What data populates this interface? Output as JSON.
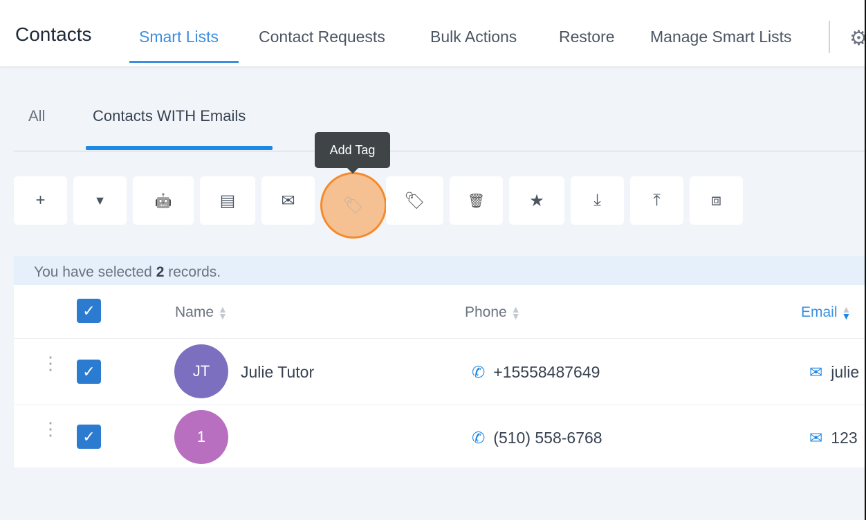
{
  "header": {
    "title": "Contacts",
    "tabs": [
      {
        "label": "Smart Lists",
        "active": true
      },
      {
        "label": "Contact Requests"
      },
      {
        "label": "Bulk Actions"
      },
      {
        "label": "Restore"
      },
      {
        "label": "Manage Smart Lists"
      }
    ],
    "settings_icon": "gear-icon"
  },
  "subtabs": [
    {
      "label": "All"
    },
    {
      "label": "Contacts WITH Emails",
      "active": true
    }
  ],
  "tooltip": "Add Tag",
  "toolbar": [
    {
      "icon": "plus-icon",
      "glyph": "+"
    },
    {
      "icon": "filter-icon",
      "glyph": "▼"
    },
    {
      "icon": "robot-icon",
      "glyph": "🤖"
    },
    {
      "icon": "message-icon",
      "glyph": "▤"
    },
    {
      "icon": "email-icon",
      "glyph": "✉"
    },
    {
      "icon": "add-tag-icon",
      "glyph": "🏷"
    },
    {
      "icon": "remove-tag-icon",
      "glyph": "🏷"
    },
    {
      "icon": "trash-icon",
      "glyph": "🗑"
    },
    {
      "icon": "star-icon",
      "glyph": "★"
    },
    {
      "icon": "download-icon",
      "glyph": "⤓"
    },
    {
      "icon": "upload-icon",
      "glyph": "⤒"
    },
    {
      "icon": "merge-icon",
      "glyph": "⧈"
    }
  ],
  "selection": {
    "prefix": "You have selected ",
    "count": "2",
    "suffix": " records."
  },
  "table": {
    "columns": [
      "Name",
      "Phone",
      "Email"
    ],
    "rows": [
      {
        "initials": "JT",
        "name": "Julie Tutor",
        "phone": "+15558487649",
        "email": "julie",
        "avatar_color": "#7c6fc0"
      },
      {
        "initials": "1",
        "name": "",
        "phone": "(510) 558-6768",
        "email": "123",
        "avatar_color": "#b86fbf"
      }
    ]
  },
  "colors": {
    "accent": "#3b8fe0",
    "highlight": "#f58a2c"
  }
}
